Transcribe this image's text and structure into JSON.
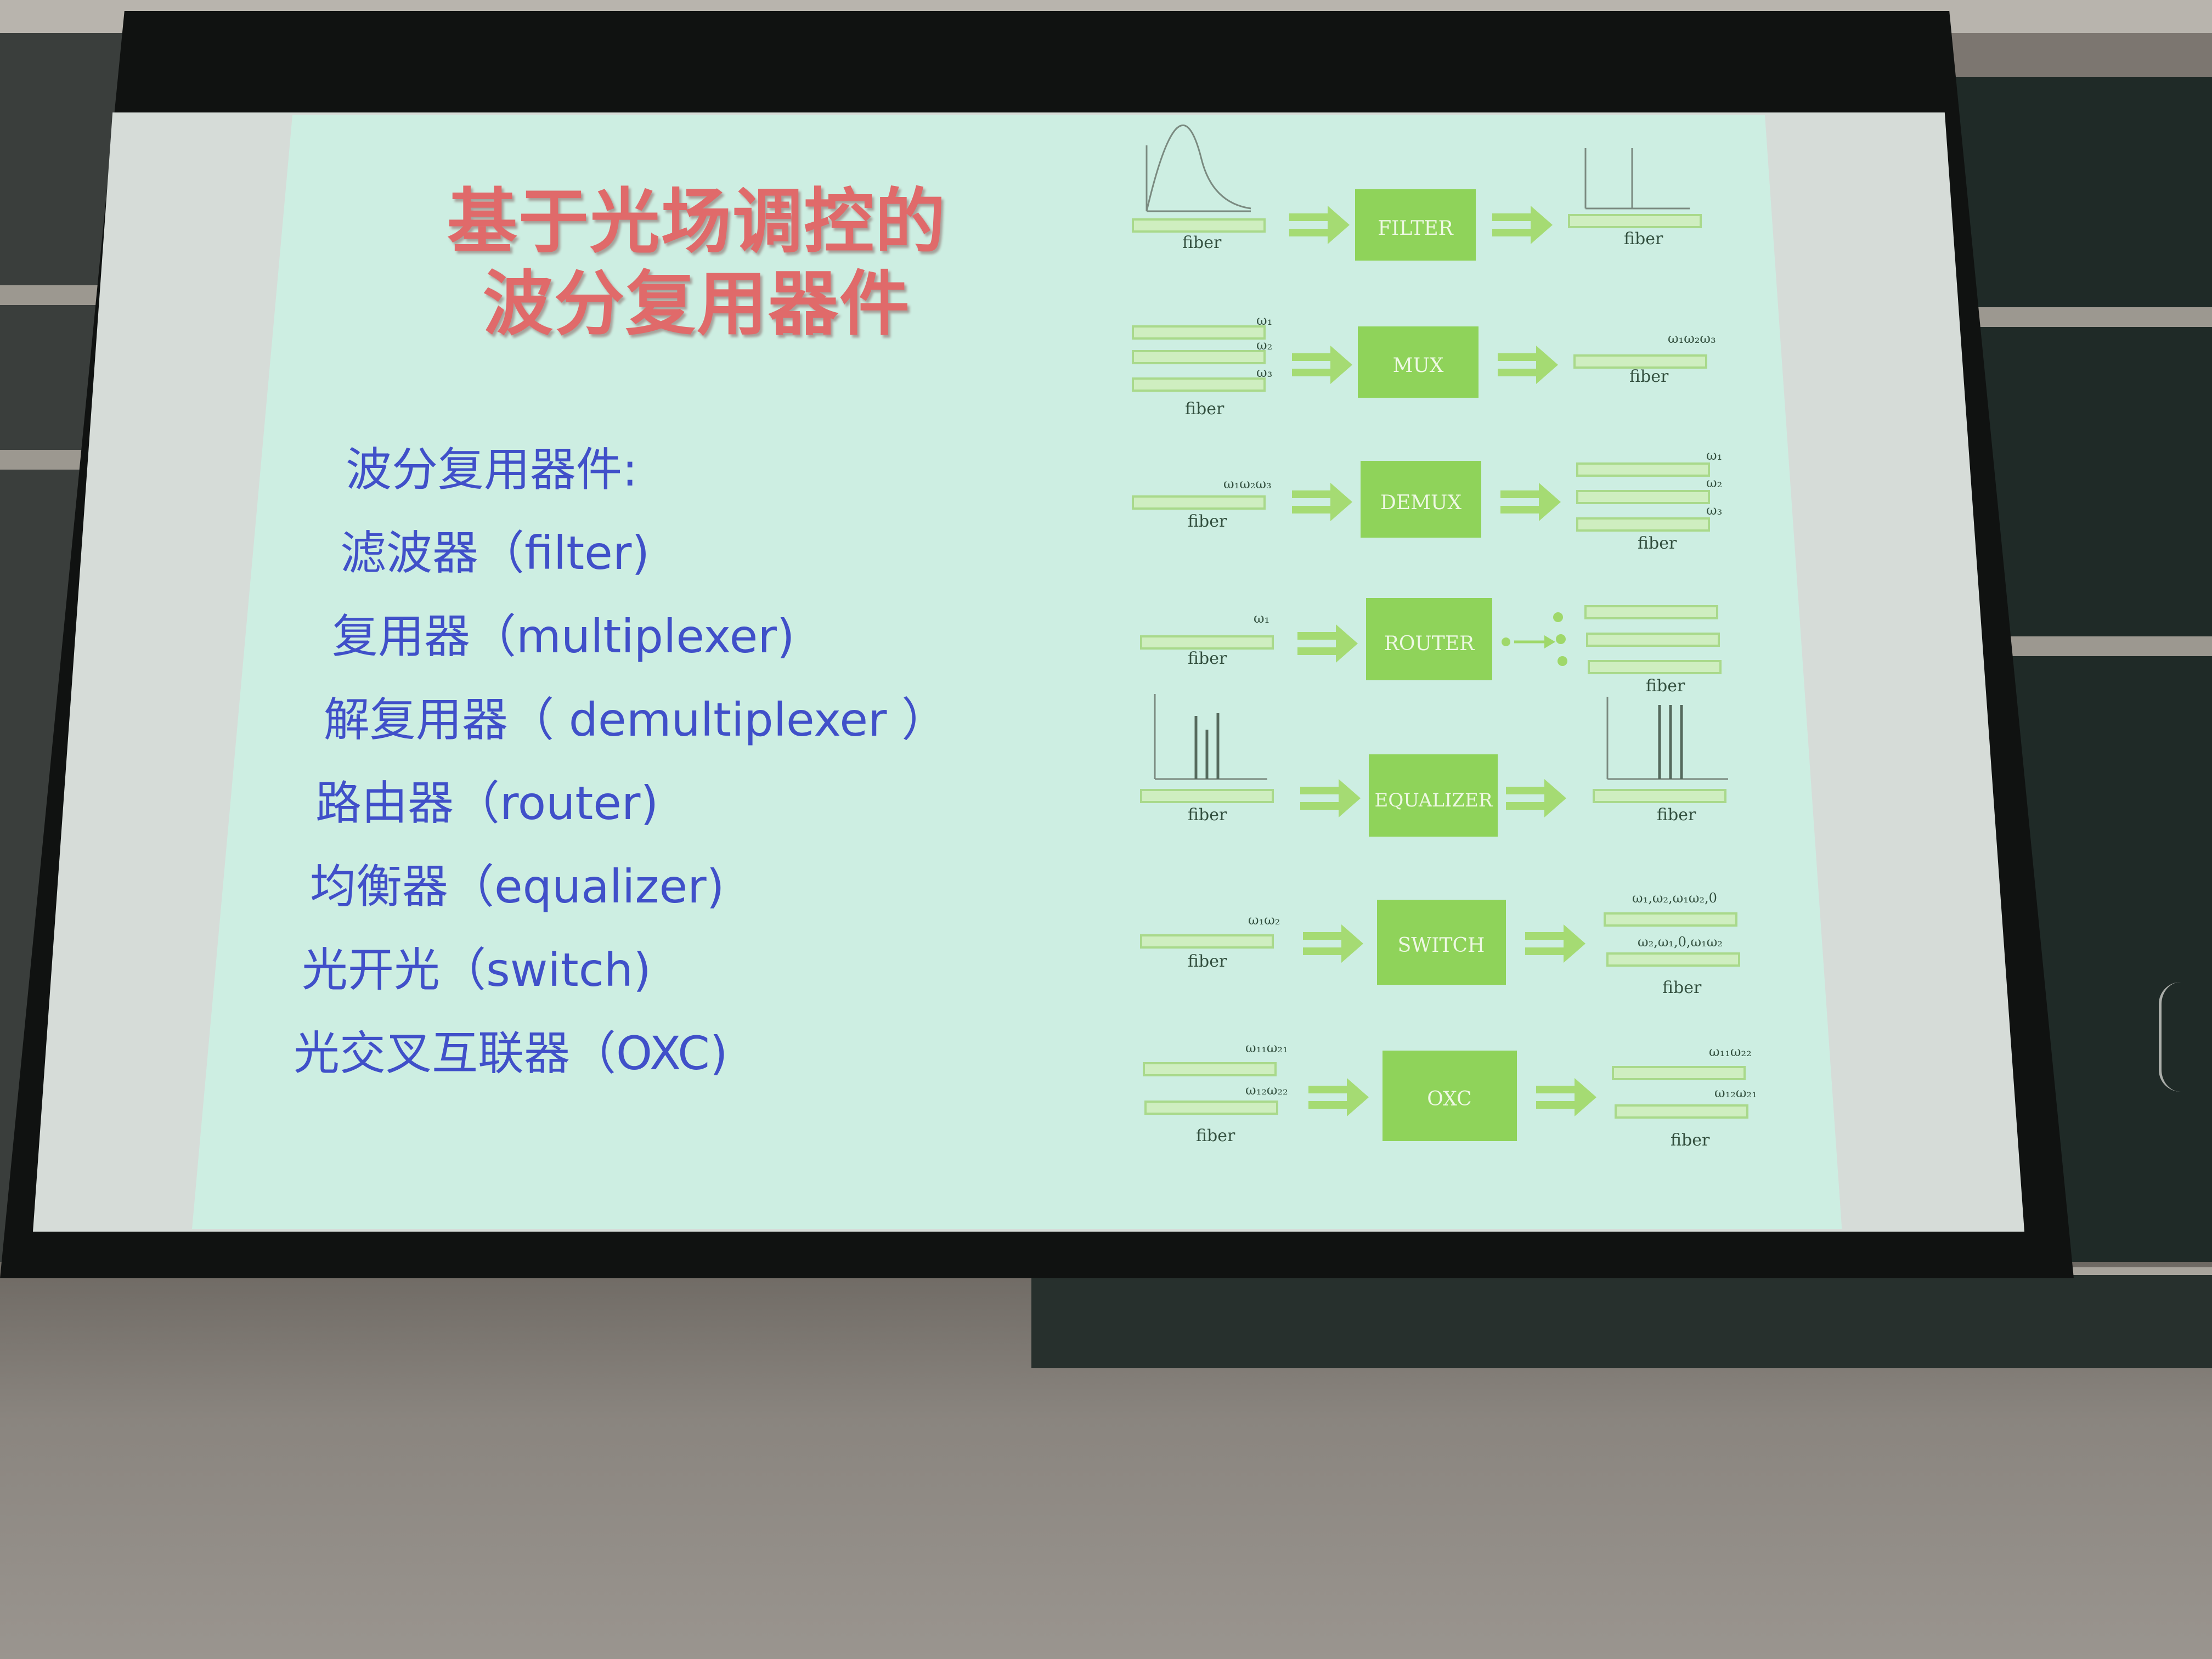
{
  "slide": {
    "title_line1": "基于光场调控的",
    "title_line2": "波分复用器件",
    "list": [
      "波分复用器件:",
      "滤波器（filter)",
      "复用器（multiplexer)",
      "解复用器（ demultiplexer ）",
      "路由器（router)",
      "均衡器（equalizer)",
      "光开光（switch)",
      "光交叉互联器（OXC)"
    ]
  },
  "diagram": {
    "fiber_label": "fiber",
    "boxes": [
      "FILTER",
      "MUX",
      "DEMUX",
      "ROUTER",
      "EQUALIZER",
      "SWITCH",
      "OXC"
    ],
    "labels": {
      "mux_in_1": "ω₁",
      "mux_in_2": "ω₂",
      "mux_in_3": "ω₃",
      "mux_out": "ω₁ω₂ω₃",
      "demux_in": "ω₁ω₂ω₃",
      "demux_out_1": "ω₁",
      "demux_out_2": "ω₂",
      "demux_out_3": "ω₃",
      "router_in": "ω₁",
      "switch_in": "ω₁ω₂",
      "switch_out_1": "ω₁,ω₂,ω₁ω₂,0",
      "switch_out_2": "ω₂,ω₁,0,ω₁ω₂",
      "oxc_in_1": "ω₁₁ω₂₁",
      "oxc_in_2": "ω₁₂ω₂₂",
      "oxc_out_1": "ω₁₁ω₂₂",
      "oxc_out_2": "ω₁₂ω₂₁"
    },
    "colors": {
      "box": "#8fd35a",
      "arrow": "#9fd86a",
      "fiber": "#b9e39a",
      "label": "#2f4a3a"
    }
  }
}
